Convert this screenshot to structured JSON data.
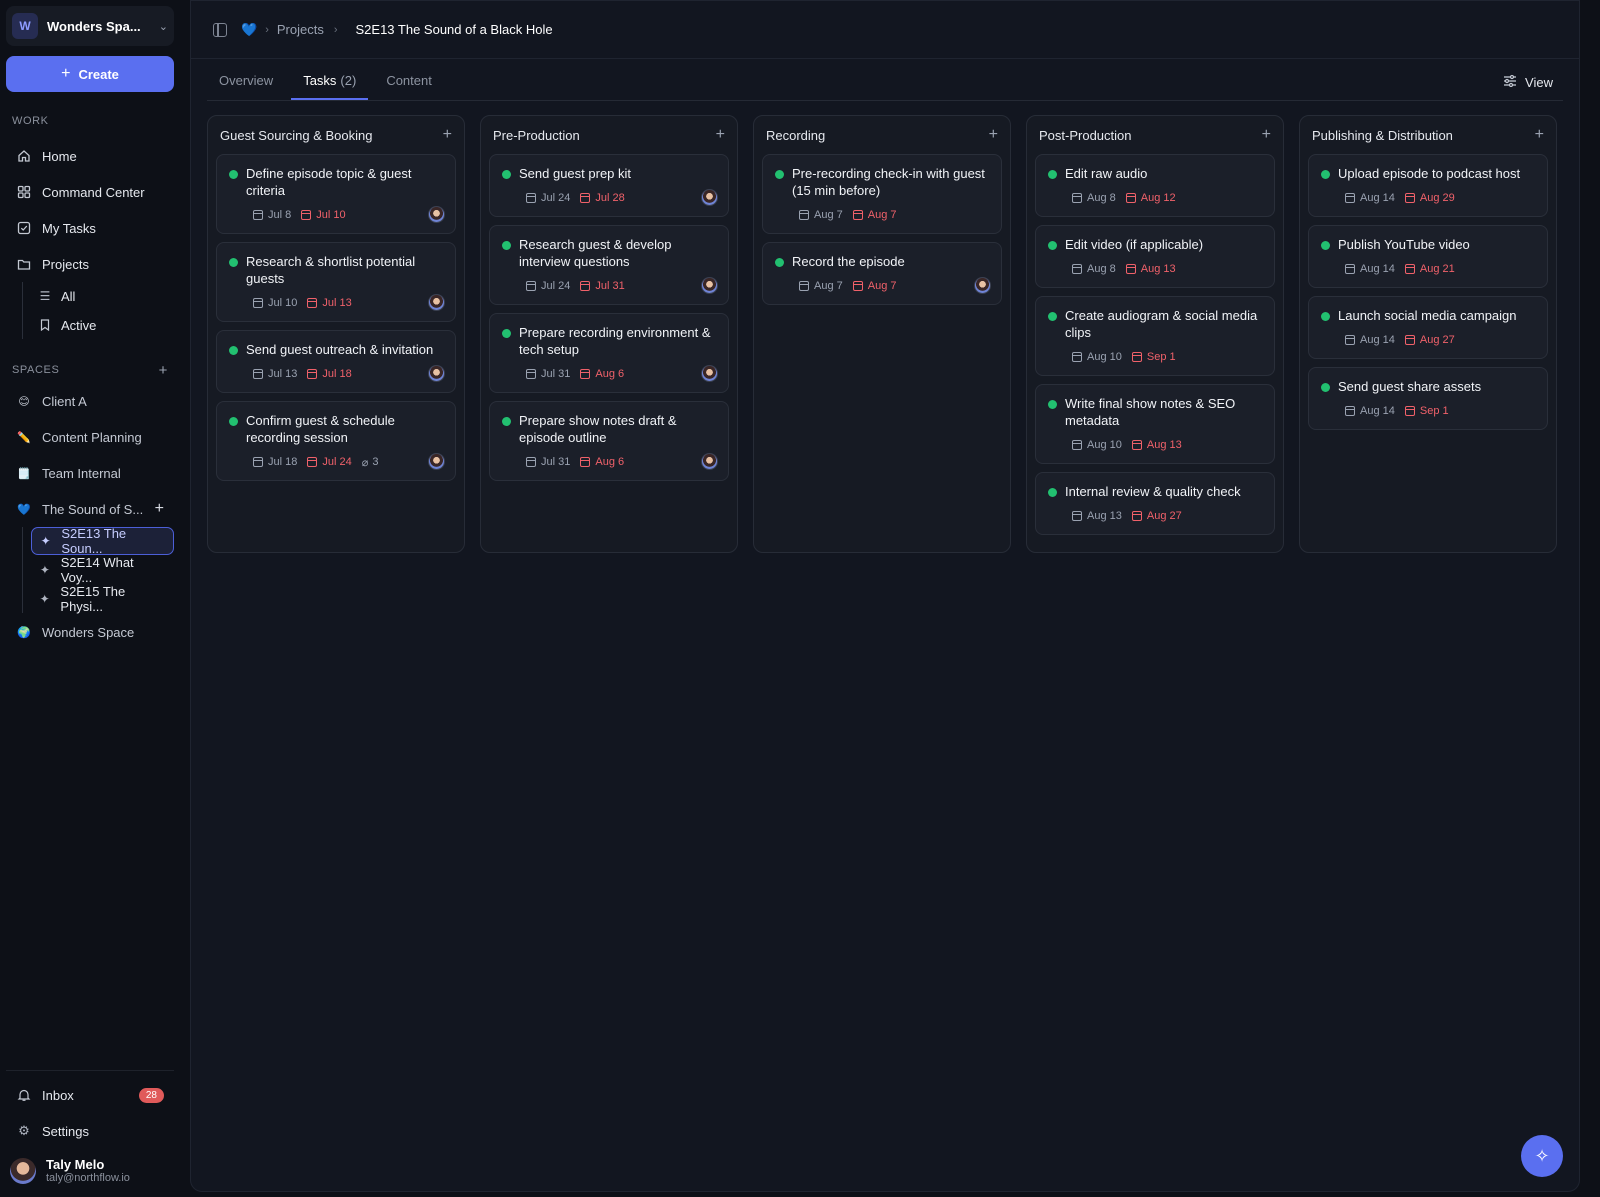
{
  "workspace": {
    "initial": "W",
    "name": "Wonders Spa..."
  },
  "create_label": "Create",
  "work_label": "WORK",
  "nav": [
    {
      "label": "Home",
      "icon": "home-icon"
    },
    {
      "label": "Command Center",
      "icon": "grid-icon"
    },
    {
      "label": "My Tasks",
      "icon": "checkbox-icon"
    },
    {
      "label": "Projects",
      "icon": "folder-icon"
    }
  ],
  "projects_sub": [
    {
      "label": "All",
      "icon": "list-icon"
    },
    {
      "label": "Active",
      "icon": "bookmark-icon"
    }
  ],
  "spaces_label": "SPACES",
  "spaces": [
    {
      "label": "Client A",
      "emoji": "😊"
    },
    {
      "label": "Content Planning",
      "emoji": "✏️"
    },
    {
      "label": "Team Internal",
      "emoji": "🗒️"
    },
    {
      "label": "The Sound of S...",
      "emoji": "💙"
    }
  ],
  "episodes": [
    {
      "label": "S2E13 The Soun..."
    },
    {
      "label": "S2E14 What Voy..."
    },
    {
      "label": "S2E15 The Physi..."
    }
  ],
  "wonders_space": {
    "label": "Wonders Space",
    "emoji": "🌍"
  },
  "inbox": {
    "label": "Inbox",
    "count": "28"
  },
  "settings_label": "Settings",
  "user": {
    "name": "Taly Melo",
    "email": "taly@northflow.io"
  },
  "breadcrumb": {
    "emoji": "💙",
    "projects": "Projects",
    "current": "S2E13 The Sound of a Black Hole"
  },
  "tabs": [
    {
      "label": "Overview"
    },
    {
      "label": "Tasks",
      "count": "(2)"
    },
    {
      "label": "Content"
    }
  ],
  "view_label": "View",
  "columns": [
    {
      "title": "Guest Sourcing & Booking",
      "cards": [
        {
          "title": "Define episode topic & guest criteria",
          "start": "Jul 8",
          "due": "Jul 10",
          "avatar": true
        },
        {
          "title": "Research & shortlist potential guests",
          "start": "Jul 10",
          "due": "Jul 13",
          "avatar": true
        },
        {
          "title": "Send guest outreach & invitation",
          "start": "Jul 13",
          "due": "Jul 18",
          "avatar": true
        },
        {
          "title": "Confirm guest & schedule recording session",
          "start": "Jul 18",
          "due": "Jul 24",
          "attachments": "3",
          "avatar": true
        }
      ]
    },
    {
      "title": "Pre-Production",
      "cards": [
        {
          "title": "Send guest prep kit",
          "start": "Jul 24",
          "due": "Jul 28",
          "avatar": true
        },
        {
          "title": "Research guest & develop interview questions",
          "start": "Jul 24",
          "due": "Jul 31",
          "avatar": true
        },
        {
          "title": "Prepare recording environment & tech setup",
          "start": "Jul 31",
          "due": "Aug 6",
          "avatar": true
        },
        {
          "title": "Prepare show notes draft & episode outline",
          "start": "Jul 31",
          "due": "Aug 6",
          "avatar": true
        }
      ]
    },
    {
      "title": "Recording",
      "cards": [
        {
          "title": "Pre-recording check-in with guest (15 min before)",
          "start": "Aug 7",
          "due": "Aug 7",
          "avatar": false
        },
        {
          "title": "Record the episode",
          "start": "Aug 7",
          "due": "Aug 7",
          "avatar": true
        }
      ]
    },
    {
      "title": "Post-Production",
      "cards": [
        {
          "title": "Edit raw audio",
          "start": "Aug 8",
          "due": "Aug 12",
          "avatar": false
        },
        {
          "title": "Edit video (if applicable)",
          "start": "Aug 8",
          "due": "Aug 13",
          "avatar": false
        },
        {
          "title": "Create audiogram & social media clips",
          "start": "Aug 10",
          "due": "Sep 1",
          "avatar": false
        },
        {
          "title": "Write final show notes & SEO metadata",
          "start": "Aug 10",
          "due": "Aug 13",
          "avatar": false
        },
        {
          "title": "Internal review & quality check",
          "start": "Aug 13",
          "due": "Aug 27",
          "avatar": false
        }
      ]
    },
    {
      "title": "Publishing & Distribution",
      "cards": [
        {
          "title": "Upload episode to podcast host",
          "start": "Aug 14",
          "due": "Aug 29",
          "avatar": false
        },
        {
          "title": "Publish YouTube video",
          "start": "Aug 14",
          "due": "Aug 21",
          "avatar": false
        },
        {
          "title": "Launch social media campaign",
          "start": "Aug 14",
          "due": "Aug 27",
          "avatar": false
        },
        {
          "title": "Send guest share assets",
          "start": "Aug 14",
          "due": "Sep 1",
          "avatar": false
        }
      ]
    }
  ],
  "colors": {
    "accent": "#5a6ff0",
    "status_dot": "#22c070",
    "due": "#f0616a",
    "badge": "#e05a5a"
  }
}
